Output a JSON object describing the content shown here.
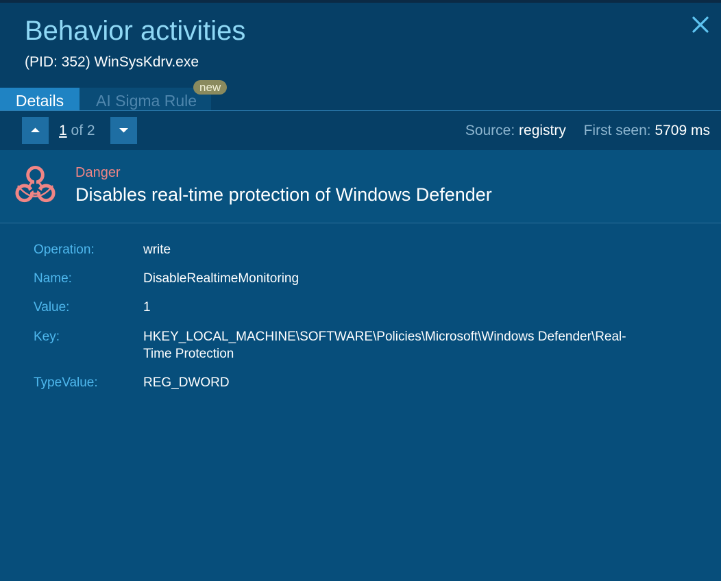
{
  "header": {
    "title": "Behavior activities",
    "subtitle": "(PID: 352) WinSysKdrv.exe",
    "close_icon": "close-icon"
  },
  "tabs": [
    {
      "label": "Details",
      "active": true
    },
    {
      "label": "AI Sigma Rule",
      "active": false,
      "badge": "new"
    }
  ],
  "pager": {
    "current": "1",
    "total_text": "of 2",
    "prev_icon": "arrow-up-icon",
    "next_icon": "arrow-down-icon"
  },
  "meta": {
    "source_label": "Source:",
    "source_value": "registry",
    "first_seen_label": "First seen:",
    "first_seen_value": "5709 ms"
  },
  "alert": {
    "severity": "Danger",
    "severity_color": "#f08585",
    "icon": "biohazard-icon",
    "title": "Disables real-time protection of Windows Defender"
  },
  "details": [
    {
      "key": "Operation:",
      "value": "write"
    },
    {
      "key": "Name:",
      "value": "DisableRealtimeMonitoring"
    },
    {
      "key": "Value:",
      "value": "1"
    },
    {
      "key": "Key:",
      "value": "HKEY_LOCAL_MACHINE\\SOFTWARE\\Policies\\Microsoft\\Windows Defender\\Real-Time Protection"
    },
    {
      "key": "TypeValue:",
      "value": "REG_DWORD"
    }
  ],
  "colors": {
    "background": "#08527f",
    "header": "#063f66",
    "accent": "#1f83c3",
    "title": "#8fd8f5",
    "label": "#4fb8ee"
  }
}
